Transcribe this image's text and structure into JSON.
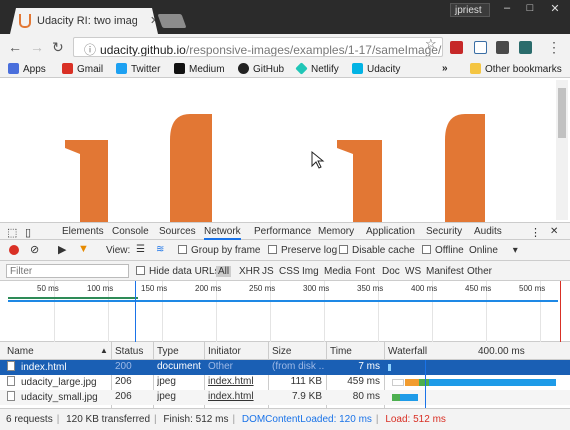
{
  "colors": {
    "accent": "#e27734",
    "selection": "#1a5fb4",
    "active_tab": "#1a73e8",
    "dom_loaded": "#1a73e8",
    "load": "#d93025"
  },
  "browser": {
    "tab_title": "Udacity RI: two images, s",
    "tab_close": "✕",
    "user": "jpriest",
    "window_buttons": [
      "–",
      "□",
      "✕"
    ],
    "url_host": "udacity.github.io",
    "url_path": "/responsive-images/examples/1-17/sameImage/ind...",
    "bookmarks": [
      {
        "label": "Apps",
        "icon": "apps-icon"
      },
      {
        "label": "Gmail",
        "icon": "gmail-icon"
      },
      {
        "label": "Twitter",
        "icon": "twitter-icon"
      },
      {
        "label": "Medium",
        "icon": "medium-icon"
      },
      {
        "label": "GitHub",
        "icon": "github-icon"
      },
      {
        "label": "Netlify",
        "icon": "netlify-icon"
      },
      {
        "label": "Udacity",
        "icon": "udacity-icon"
      }
    ],
    "bookmarks_more": "»",
    "other_bookmarks": "Other bookmarks"
  },
  "devtools": {
    "tabs": [
      "Elements",
      "Console",
      "Sources",
      "Network",
      "Performance",
      "Memory",
      "Application",
      "Security",
      "Audits"
    ],
    "active_tab": "Network",
    "view_label": "View:",
    "group_by_frame": "Group by frame",
    "preserve_log": "Preserve log",
    "disable_cache": "Disable cache",
    "offline": "Offline",
    "throttle": "Online",
    "filter_placeholder": "Filter",
    "hide_data_urls": "Hide data URLs",
    "filter_types": [
      "All",
      "XHR",
      "JS",
      "CSS",
      "Img",
      "Media",
      "Font",
      "Doc",
      "WS",
      "Manifest",
      "Other"
    ],
    "timeline_ticks": [
      "50 ms",
      "100 ms",
      "150 ms",
      "200 ms",
      "250 ms",
      "300 ms",
      "350 ms",
      "400 ms",
      "450 ms",
      "500 ms"
    ],
    "columns": [
      "Name",
      "Status",
      "Type",
      "Initiator",
      "Size",
      "Time",
      "Waterfall"
    ],
    "waterfall_tick": "400.00 ms",
    "rows": [
      {
        "name": "index.html",
        "status": "200",
        "type": "document",
        "initiator": "Other",
        "size": "(from disk ...",
        "time": "7 ms",
        "selected": true
      },
      {
        "name": "udacity_large.jpg",
        "status": "206",
        "type": "jpeg",
        "initiator": "index.html",
        "size": "111 KB",
        "time": "459 ms"
      },
      {
        "name": "udacity_small.jpg",
        "status": "206",
        "type": "jpeg",
        "initiator": "index.html",
        "size": "7.9 KB",
        "time": "80 ms"
      }
    ],
    "status": {
      "requests": "6 requests",
      "transferred": "120 KB transferred",
      "finish": "Finish: 512 ms",
      "dom": "DOMContentLoaded: 120 ms",
      "load": "Load: 512 ms"
    }
  }
}
